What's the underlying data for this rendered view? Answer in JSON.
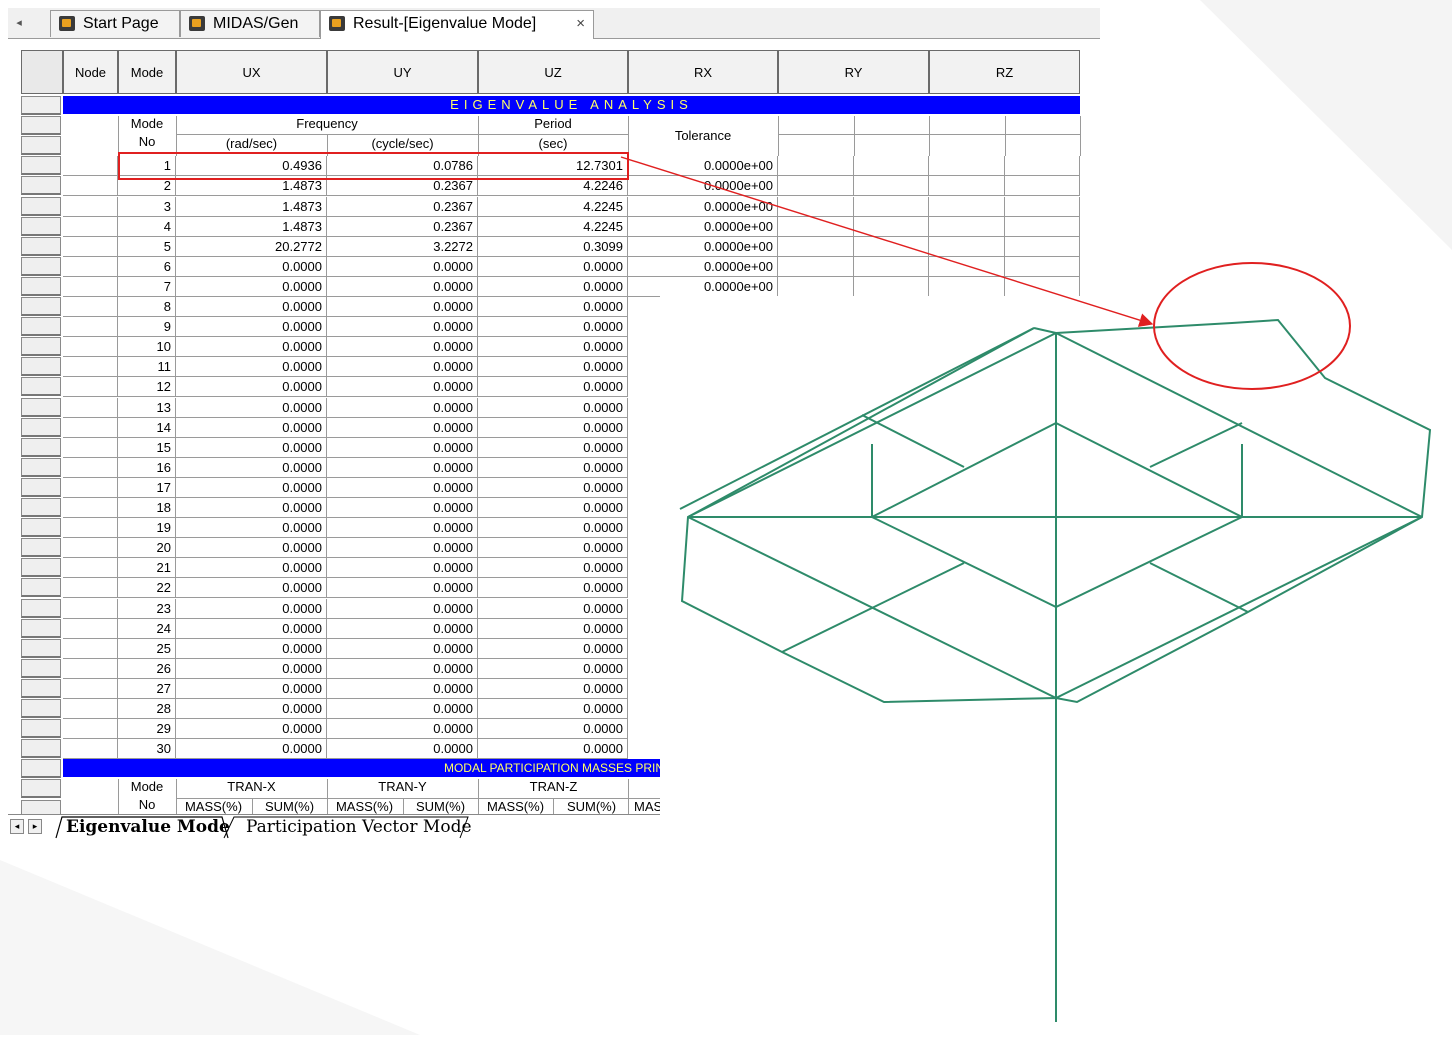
{
  "tabs": [
    {
      "label": "Start Page"
    },
    {
      "label": "MIDAS/Gen"
    },
    {
      "label": "Result-[Eigenvalue Mode]"
    }
  ],
  "tab_scroll_glyph": "◂",
  "close_glyph": "×",
  "columns": [
    "Node",
    "Mode",
    "UX",
    "UY",
    "UZ",
    "RX",
    "RY",
    "RZ"
  ],
  "eigen_title": "EIGENVALUE  ANALYSIS",
  "eigen_header": {
    "mode": "Mode",
    "no": "No",
    "frequency": "Frequency",
    "rad_unit": "(rad/sec)",
    "cycle_unit": "(cycle/sec)",
    "period": "Period",
    "sec_unit": "(sec)",
    "tolerance": "Tolerance"
  },
  "eigen_rows": [
    {
      "mode": "1",
      "rad": "0.4936",
      "cycle": "0.0786",
      "period": "12.7301",
      "tol": "0.0000e+00"
    },
    {
      "mode": "2",
      "rad": "1.4873",
      "cycle": "0.2367",
      "period": "4.2246",
      "tol": "0.0000e+00"
    },
    {
      "mode": "3",
      "rad": "1.4873",
      "cycle": "0.2367",
      "period": "4.2245",
      "tol": "0.0000e+00"
    },
    {
      "mode": "4",
      "rad": "1.4873",
      "cycle": "0.2367",
      "period": "4.2245",
      "tol": "0.0000e+00"
    },
    {
      "mode": "5",
      "rad": "20.2772",
      "cycle": "3.2272",
      "period": "0.3099",
      "tol": "0.0000e+00"
    },
    {
      "mode": "6",
      "rad": "0.0000",
      "cycle": "0.0000",
      "period": "0.0000",
      "tol": "0.0000e+00"
    },
    {
      "mode": "7",
      "rad": "0.0000",
      "cycle": "0.0000",
      "period": "0.0000",
      "tol": "0.0000e+00"
    },
    {
      "mode": "8",
      "rad": "0.0000",
      "cycle": "0.0000",
      "period": "0.0000",
      "tol": ""
    },
    {
      "mode": "9",
      "rad": "0.0000",
      "cycle": "0.0000",
      "period": "0.0000",
      "tol": ""
    },
    {
      "mode": "10",
      "rad": "0.0000",
      "cycle": "0.0000",
      "period": "0.0000",
      "tol": ""
    },
    {
      "mode": "11",
      "rad": "0.0000",
      "cycle": "0.0000",
      "period": "0.0000",
      "tol": ""
    },
    {
      "mode": "12",
      "rad": "0.0000",
      "cycle": "0.0000",
      "period": "0.0000",
      "tol": ""
    },
    {
      "mode": "13",
      "rad": "0.0000",
      "cycle": "0.0000",
      "period": "0.0000",
      "tol": ""
    },
    {
      "mode": "14",
      "rad": "0.0000",
      "cycle": "0.0000",
      "period": "0.0000",
      "tol": ""
    },
    {
      "mode": "15",
      "rad": "0.0000",
      "cycle": "0.0000",
      "period": "0.0000",
      "tol": ""
    },
    {
      "mode": "16",
      "rad": "0.0000",
      "cycle": "0.0000",
      "period": "0.0000",
      "tol": ""
    },
    {
      "mode": "17",
      "rad": "0.0000",
      "cycle": "0.0000",
      "period": "0.0000",
      "tol": ""
    },
    {
      "mode": "18",
      "rad": "0.0000",
      "cycle": "0.0000",
      "period": "0.0000",
      "tol": ""
    },
    {
      "mode": "19",
      "rad": "0.0000",
      "cycle": "0.0000",
      "period": "0.0000",
      "tol": ""
    },
    {
      "mode": "20",
      "rad": "0.0000",
      "cycle": "0.0000",
      "period": "0.0000",
      "tol": ""
    },
    {
      "mode": "21",
      "rad": "0.0000",
      "cycle": "0.0000",
      "period": "0.0000",
      "tol": ""
    },
    {
      "mode": "22",
      "rad": "0.0000",
      "cycle": "0.0000",
      "period": "0.0000",
      "tol": ""
    },
    {
      "mode": "23",
      "rad": "0.0000",
      "cycle": "0.0000",
      "period": "0.0000",
      "tol": ""
    },
    {
      "mode": "24",
      "rad": "0.0000",
      "cycle": "0.0000",
      "period": "0.0000",
      "tol": ""
    },
    {
      "mode": "25",
      "rad": "0.0000",
      "cycle": "0.0000",
      "period": "0.0000",
      "tol": ""
    },
    {
      "mode": "26",
      "rad": "0.0000",
      "cycle": "0.0000",
      "period": "0.0000",
      "tol": ""
    },
    {
      "mode": "27",
      "rad": "0.0000",
      "cycle": "0.0000",
      "period": "0.0000",
      "tol": ""
    },
    {
      "mode": "28",
      "rad": "0.0000",
      "cycle": "0.0000",
      "period": "0.0000",
      "tol": ""
    },
    {
      "mode": "29",
      "rad": "0.0000",
      "cycle": "0.0000",
      "period": "0.0000",
      "tol": ""
    },
    {
      "mode": "30",
      "rad": "0.0000",
      "cycle": "0.0000",
      "period": "0.0000",
      "tol": ""
    }
  ],
  "mpm_title": "MODAL PARTICIPATION MASSES PRIN",
  "mpm_header": {
    "mode": "Mode",
    "no": "No",
    "groups": [
      "TRAN-X",
      "TRAN-Y",
      "TRAN-Z"
    ],
    "mass": "MASS(%)",
    "sum": "SUM(%)",
    "trunc": "MASS"
  },
  "sheet_tabs": [
    "Eigenvalue Mode",
    "Participation Vector Mode"
  ],
  "nav_glyphs": [
    "◂",
    "▸"
  ],
  "colors": {
    "band_bg": "#0000ff",
    "band_text": "#ffff66",
    "highlight": "#e02020",
    "model_line": "#2e8b6a"
  }
}
